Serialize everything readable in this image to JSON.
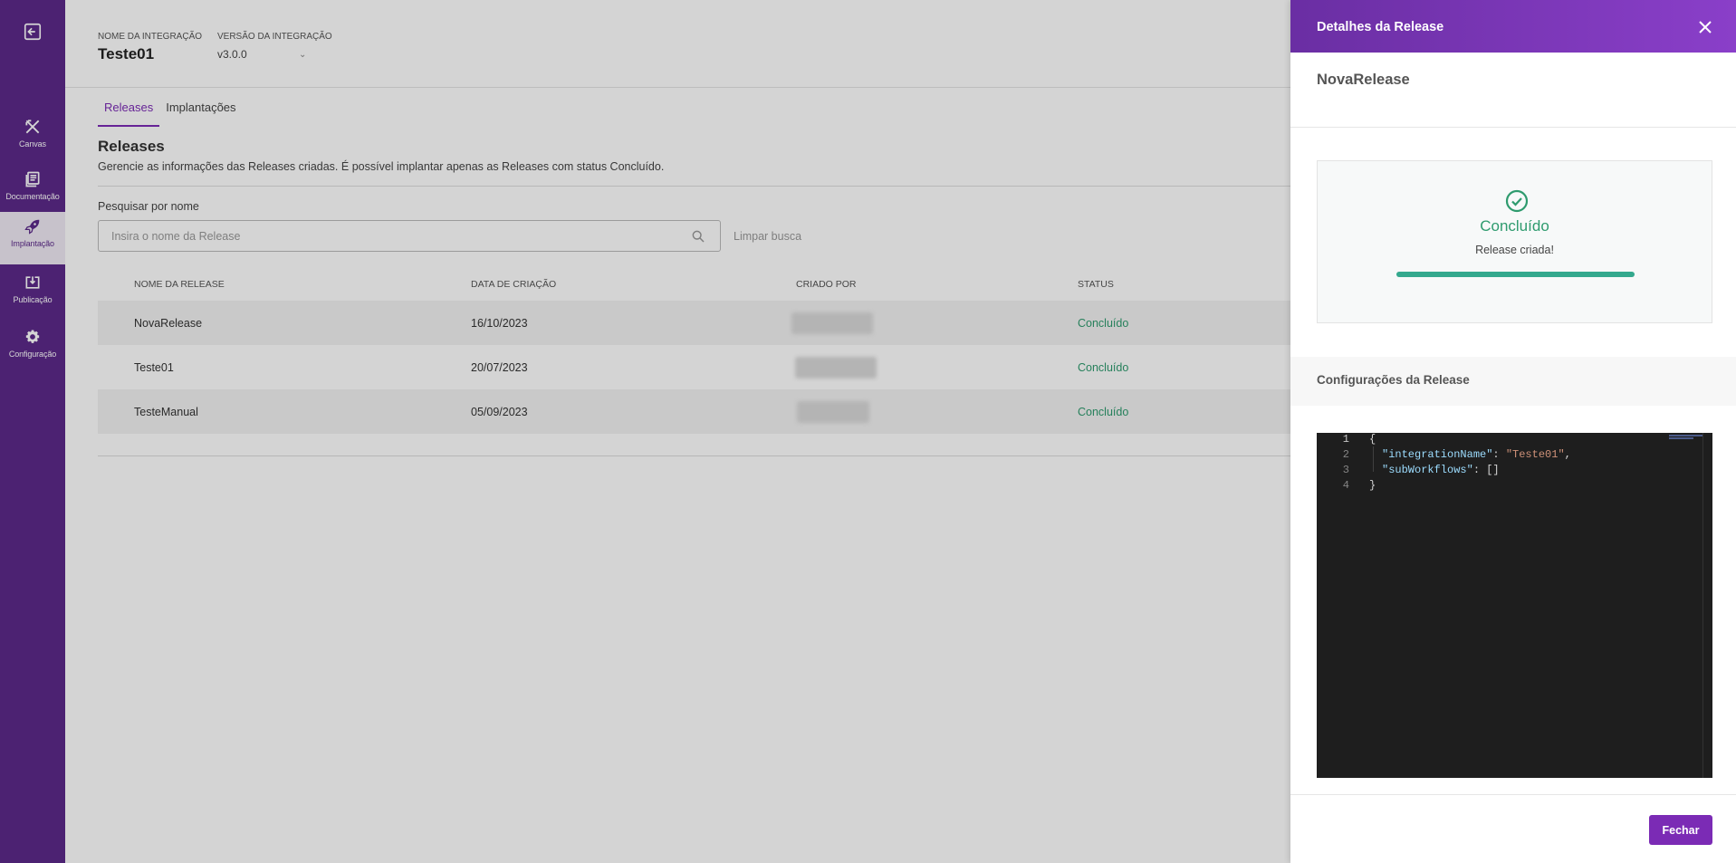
{
  "sidebar": {
    "exit_icon": "exit-icon",
    "items": [
      {
        "label": "Canvas",
        "icon": "canvas-icon"
      },
      {
        "label": "Documentação",
        "icon": "book-icon"
      },
      {
        "label": "Implantação",
        "icon": "rocket-icon",
        "active": true
      },
      {
        "label": "Publicação",
        "icon": "publish-icon"
      },
      {
        "label": "Configuração",
        "icon": "gear-icon"
      }
    ]
  },
  "header": {
    "integration_name_label": "NOME DA INTEGRAÇÃO",
    "integration_name": "Teste01",
    "version_label": "VERSÃO DA INTEGRAÇÃO",
    "version": "v3.0.0"
  },
  "tabs": [
    {
      "label": "Releases",
      "active": true
    },
    {
      "label": "Implantações"
    }
  ],
  "releases": {
    "title": "Releases",
    "description": "Gerencie as informações das Releases criadas. É possível implantar apenas as Releases com status Concluído.",
    "search_label": "Pesquisar por nome",
    "search_placeholder": "Insira o nome da Release",
    "clear_label": "Limpar busca",
    "columns": [
      "NOME DA RELEASE",
      "DATA DE CRIAÇÃO",
      "CRIADO POR",
      "STATUS"
    ],
    "rows": [
      {
        "name": "NovaRelease",
        "date": "16/10/2023",
        "status": "Concluído"
      },
      {
        "name": "Teste01",
        "date": "20/07/2023",
        "status": "Concluído"
      },
      {
        "name": "TesteManual",
        "date": "05/09/2023",
        "status": "Concluído"
      }
    ]
  },
  "drawer": {
    "title": "Detalhes da Release",
    "release_name": "NovaRelease",
    "status_label": "Concluído",
    "status_message": "Release criada!",
    "progress": 1.0,
    "config_title": "Configurações da Release",
    "code": {
      "line_numbers": [
        "1",
        "2",
        "3",
        "4"
      ],
      "open_brace": "{",
      "key1": "\"integrationName\"",
      "val1": "\"Teste01\"",
      "key2": "\"subWorkflows\"",
      "val2": "[]",
      "close_brace": "}"
    },
    "close_button": "Fechar"
  },
  "colors": {
    "sidebar": "#5c2a8a",
    "accent": "#7b2bb5",
    "success": "#2e9b6e"
  }
}
